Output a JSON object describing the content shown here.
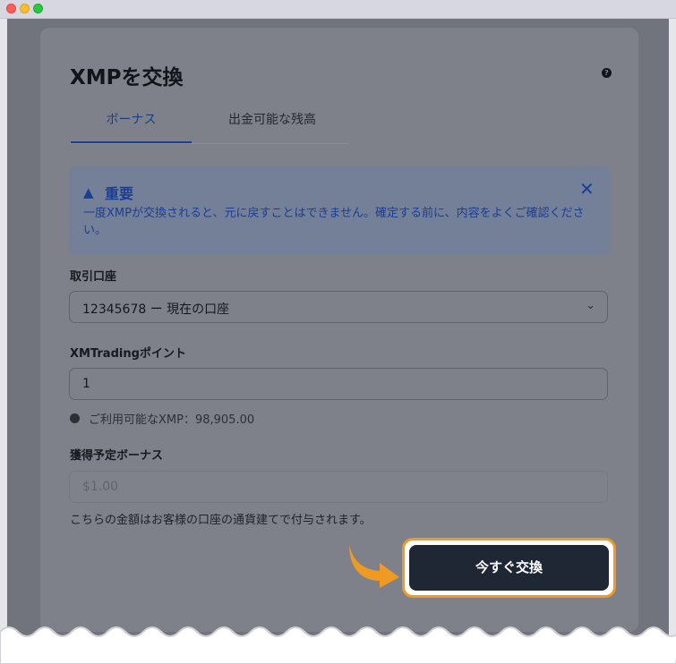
{
  "window": {
    "controls": [
      "close",
      "minimize",
      "maximize"
    ]
  },
  "dialog": {
    "title": "XMPを交換",
    "help_icon": "question-circle-icon",
    "tabs": [
      {
        "label": "ボーナス",
        "active": true
      },
      {
        "label": "出金可能な残高",
        "active": false
      }
    ],
    "alert": {
      "icon": "warning-triangle-icon",
      "title": "重要",
      "message": "一度XMPが交換されると、元に戻すことはできません。確定する前に、内容をよくご確認ください。",
      "close_icon": "close-x-icon"
    },
    "account": {
      "label": "取引口座",
      "selected": "12345678 ー 現在の口座"
    },
    "points": {
      "label": "XMTradingポイント",
      "value": "1",
      "available": "ご利用可能なXMP：98,905.00"
    },
    "bonus": {
      "label": "獲得予定ボーナス",
      "placeholder": "$1.00",
      "note": "こちらの金額はお客様の口座の通貨建てで付与されます。"
    },
    "submit_label": "今すぐ交換"
  },
  "colors": {
    "overlay": "#71747c",
    "highlight": "#ef9a23",
    "button": "#202734",
    "alert_text": "#1b3e95"
  }
}
